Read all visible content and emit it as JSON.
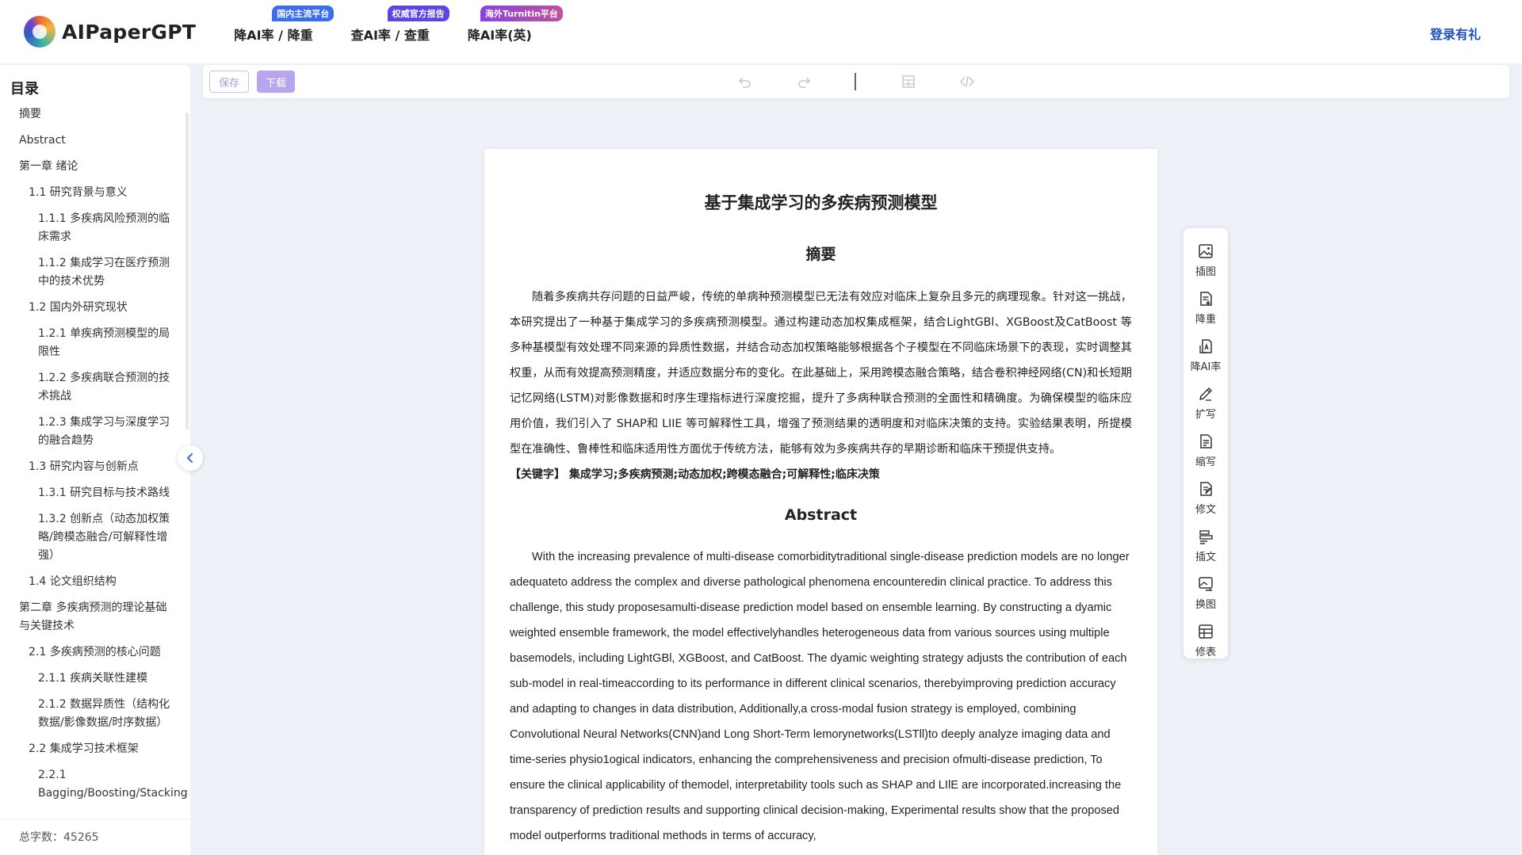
{
  "header": {
    "logo_text": "AIPaperGPT",
    "nav": [
      {
        "label": "降AI率 / 降重",
        "badge": "国内主流平台",
        "badge_color": "#3a6cf0"
      },
      {
        "label": "查AI率 / 查重",
        "badge": "权威官方报告",
        "badge_color": "#5b45e6"
      },
      {
        "label": "降AI率(英)",
        "badge": "海外Turnitin平台",
        "badge_color": "#8a42e0"
      }
    ],
    "login_label": "登录有礼"
  },
  "toc": {
    "title": "目录",
    "items": [
      {
        "label": "摘要",
        "level": 1
      },
      {
        "label": "Abstract",
        "level": 1
      },
      {
        "label": "第一章 绪论",
        "level": 1
      },
      {
        "label": "1.1 研究背景与意义",
        "level": 2
      },
      {
        "label": "1.1.1 多疾病风险预测的临床需求",
        "level": 3
      },
      {
        "label": "1.1.2 集成学习在医疗预测中的技术优势",
        "level": 3
      },
      {
        "label": "1.2 国内外研究现状",
        "level": 2
      },
      {
        "label": "1.2.1 单疾病预测模型的局限性",
        "level": 3
      },
      {
        "label": "1.2.2 多疾病联合预测的技术挑战",
        "level": 3
      },
      {
        "label": "1.2.3 集成学习与深度学习的融合趋势",
        "level": 3
      },
      {
        "label": "1.3 研究内容与创新点",
        "level": 2
      },
      {
        "label": "1.3.1 研究目标与技术路线",
        "level": 3
      },
      {
        "label": "1.3.2 创新点（动态加权策略/跨模态融合/可解释性增强）",
        "level": 3
      },
      {
        "label": "1.4 论文组织结构",
        "level": 2
      },
      {
        "label": "第二章 多疾病预测的理论基础与关键技术",
        "level": 1
      },
      {
        "label": "2.1 多疾病预测的核心问题",
        "level": 2
      },
      {
        "label": "2.1.1 疾病关联性建模",
        "level": 3
      },
      {
        "label": "2.1.2 数据异质性（结构化数据/影像数据/时序数据）",
        "level": 3
      },
      {
        "label": "2.2 集成学习技术框架",
        "level": 2
      },
      {
        "label": "2.2.1 Bagging/Boosting/Stacking",
        "level": 3
      }
    ],
    "word_count": "总字数：45265"
  },
  "toolbar": {
    "save_label": "保存",
    "download_label": "下载"
  },
  "document": {
    "title": "基于集成学习的多疾病预测模型",
    "abstract_cn_heading": "摘要",
    "abstract_cn": "随着多疾病共存问题的日益严峻，传统的单病种预测模型已无法有效应对临床上复杂且多元的病理现象。针对这一挑战，本研究提出了一种基于集成学习的多疾病预测模型。通过构建动态加权集成框架，结合LightGBl、XGBoost及CatBoost 等多种基模型有效处理不同来源的异质性数据，并结合动态加权策略能够根据各个子模型在不同临床场景下的表现，实时调整其权重，从而有效提高预测精度，并适应数据分布的变化。在此基础上，采用跨模态融合策略，结合卷积神经网络(CN)和长短期记忆网络(LSTM)对影像数据和时序生理指标进行深度挖掘，提升了多病种联合预测的全面性和精确度。为确保模型的临床应用价值，我们引入了 SHAP和 LIIE 等可解释性工具，增强了预测结果的透明度和对临床决策的支持。实验结果表明，所提模型在准确性、鲁棒性和临床适用性方面优于传统方法，能够有效为多疾病共存的早期诊断和临床干预提供支持。",
    "keywords": "【关键字】 集成学习;多疾病预测;动态加权;跨模态融合;可解释性;临床决策",
    "abstract_en_heading": "Abstract",
    "abstract_en": "With the increasing prevalence of multi-disease comorbiditytraditional single-disease prediction models are no longer adequateto address the complex and diverse pathological phenomena encounteredin clinical practice. To address this challenge, this study proposesamulti-disease prediction model based on ensemble learning. By constructing a dyamic weighted ensemble framework, the model effectivelyhandles heterogeneous data from various sources using multiple basemodels, including LightGBl, XGBoost, and CatBoost. The dyamic weighting strategy adjusts the contribution of each sub-model in real-timeaccording to its performance in different clinical scenarios, therebyimproving prediction accuracy and adapting to changes in data distribution, Additionally,a cross-modal fusion strategy is employed, combining Convolutional Neural Networks(CNN)and Long Short-Term lemorynetworks(LSTll)to deeply analyze imaging data and time-series physio1ogical indicators, enhancing the comprehensiveness and precision ofmulti-disease prediction, To ensure the clinical applicability of themodel, interpretability tools such as SHAP and LIlE are incorporated.increasing the transparency of prediction results and supporting clinical decision-making, Experimental results show that the proposed model outperforms traditional methods in terms of accuracy,"
  },
  "tools": [
    {
      "label": "插图",
      "icon": "image-icon"
    },
    {
      "label": "降重",
      "icon": "doc-down-icon"
    },
    {
      "label": "降AI率",
      "icon": "doc-ai-icon"
    },
    {
      "label": "扩写",
      "icon": "pen-icon"
    },
    {
      "label": "缩写",
      "icon": "doc-lines-icon"
    },
    {
      "label": "修文",
      "icon": "doc-edit-icon"
    },
    {
      "label": "插文",
      "icon": "align-icon"
    },
    {
      "label": "换图",
      "icon": "image-swap-icon"
    },
    {
      "label": "修表",
      "icon": "table-icon"
    }
  ]
}
